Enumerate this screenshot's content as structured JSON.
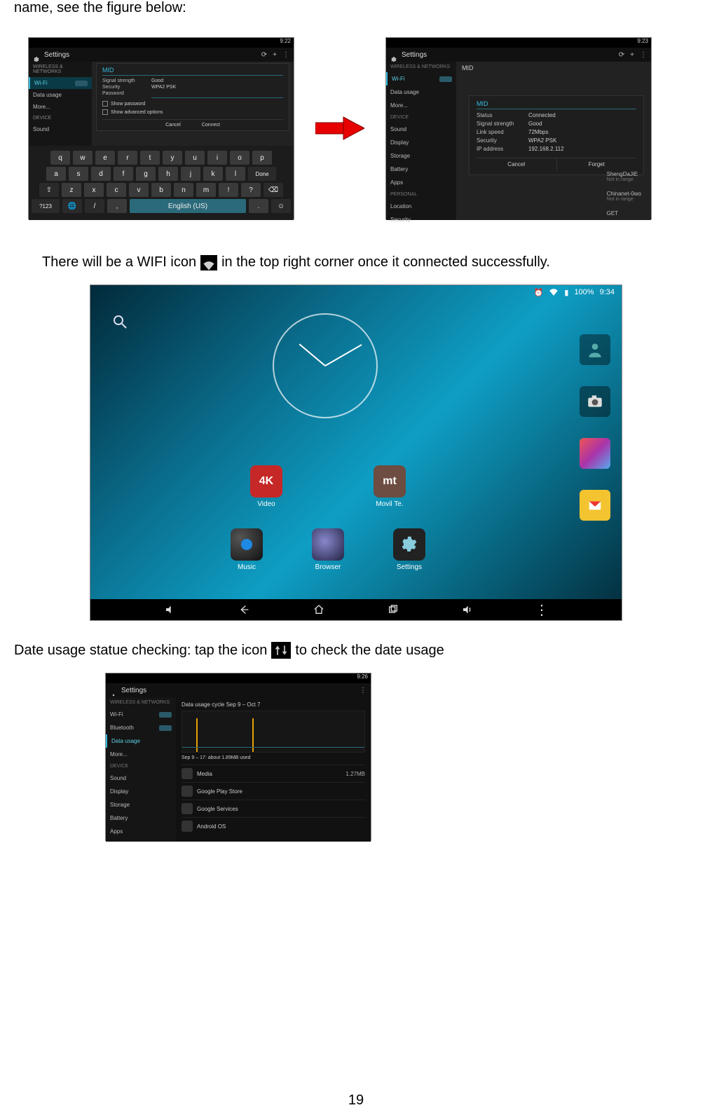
{
  "intro": "name, see the figure below:",
  "wifi_sentence_a": "There will be a WIFI icon",
  "wifi_sentence_b": "in the top right corner once it connected successfully.",
  "data_sentence_a": "Date usage statue checking: tap the icon",
  "data_sentence_b": "to check the date usage",
  "page_number": "19",
  "ss1": {
    "status_time": "9:22",
    "settings_title": "Settings",
    "actions": {
      "plus": "+",
      "menu": "⋮"
    },
    "sidebar": {
      "section": "WIRELESS & NETWORKS",
      "items": [
        {
          "label": "Wi-Fi",
          "switch": "ON"
        },
        {
          "label": "Data usage"
        },
        {
          "label": "More..."
        }
      ],
      "section2": "DEVICE",
      "device_items": [
        "Sound"
      ]
    },
    "dialog": {
      "title": "MID",
      "rows": [
        {
          "label": "Signal strength",
          "value": "Good"
        },
        {
          "label": "Security",
          "value": "WPA2 PSK"
        },
        {
          "label": "Password",
          "value": ""
        }
      ],
      "show_pwd": "Show password",
      "show_adv": "Show advanced options",
      "cancel": "Cancel",
      "connect": "Connect"
    },
    "keyboard": {
      "row1": [
        "q",
        "w",
        "e",
        "r",
        "t",
        "y",
        "u",
        "i",
        "o",
        "p"
      ],
      "row2": [
        "a",
        "s",
        "d",
        "f",
        "g",
        "h",
        "j",
        "k",
        "l"
      ],
      "row2_done": "Done",
      "row3_shift": "⇧",
      "row3": [
        "z",
        "x",
        "c",
        "v",
        "b",
        "n",
        "m",
        "!",
        "?"
      ],
      "row3_del": "⌫",
      "row4_sym": "?123",
      "row4_lang": "🌐",
      "row4_slash": "/",
      "row4_comma": ",",
      "row4_space": "English (US)",
      "row4_period": ".",
      "row4_emoji": "☺"
    }
  },
  "ss2": {
    "status_time": "9:23",
    "settings_title": "Settings",
    "sidebar": {
      "section": "WIRELESS & NETWORKS",
      "wifi": "Wi-Fi",
      "wifi_sw": "ON",
      "data_usage": "Data usage",
      "more": "More...",
      "section2": "DEVICE",
      "device_items": [
        "Sound",
        "Display",
        "Storage",
        "Battery",
        "Apps"
      ],
      "section3": "PERSONAL",
      "personal": [
        "Location",
        "Security"
      ]
    },
    "net_top": {
      "name": "MID",
      "state": "Connected"
    },
    "dialog": {
      "title": "MID",
      "rows": [
        {
          "label": "Status",
          "value": "Connected"
        },
        {
          "label": "Signal strength",
          "value": "Good"
        },
        {
          "label": "Link speed",
          "value": "72Mbps"
        },
        {
          "label": "Security",
          "value": "WPA2 PSK"
        },
        {
          "label": "IP address",
          "value": "192.168.2.112"
        }
      ],
      "cancel": "Cancel",
      "forget": "Forget"
    },
    "other_nets": [
      {
        "name": "ShengDaJiE",
        "sub": "Not in range"
      },
      {
        "name": "Chinanet-0wo",
        "sub": "Not in range"
      },
      {
        "name": "GET",
        "sub": ""
      }
    ]
  },
  "home": {
    "status": {
      "battery": "100%",
      "time": "9:34"
    },
    "apps_row1": [
      {
        "label": "Video",
        "badge": "4K"
      },
      {
        "label": "Movil Te.",
        "badge": "mt"
      }
    ],
    "apps_row2": [
      {
        "label": "Music"
      },
      {
        "label": "Browser"
      },
      {
        "label": "Settings"
      }
    ]
  },
  "ss4": {
    "settings_title": "Settings",
    "status_time": "9:26",
    "sidebar": {
      "section": "WIRELESS & NETWORKS",
      "items": [
        {
          "label": "Wi-Fi",
          "on": "ON"
        },
        {
          "label": "Bluetooth",
          "on": "ON"
        },
        {
          "label": "Data usage"
        },
        {
          "label": "More..."
        }
      ],
      "section2": "DEVICE",
      "devitems": [
        "Sound",
        "Display",
        "Storage",
        "Battery",
        "Apps"
      ]
    },
    "cycle": "Data usage cycle  Sep 9 – Oct 7",
    "range": "Sep 9 – 17: about 1.89MB used",
    "apps": [
      {
        "name": "Media",
        "value": "1.27MB"
      },
      {
        "name": "Google Play Store",
        "value": ""
      },
      {
        "name": "Google Services",
        "value": ""
      },
      {
        "name": "Android OS",
        "value": ""
      }
    ]
  }
}
